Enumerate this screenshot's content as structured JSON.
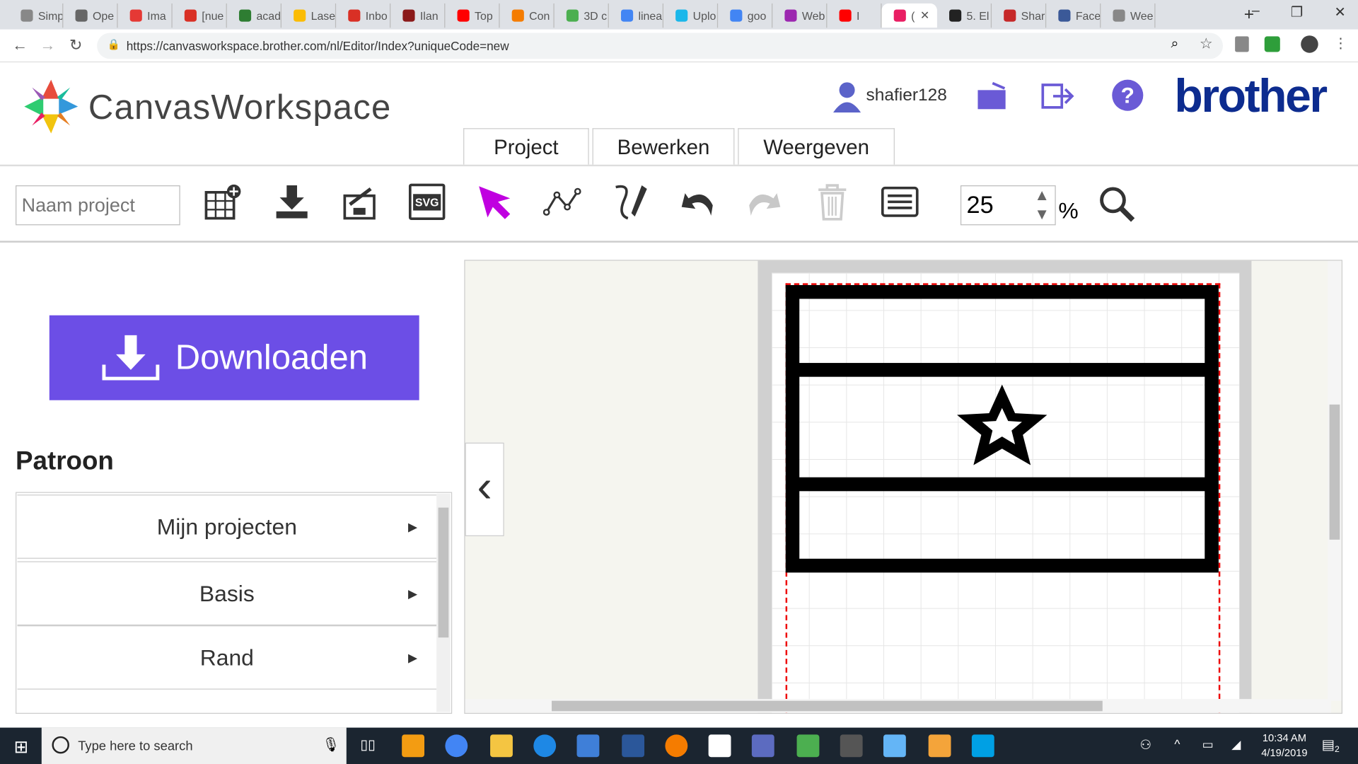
{
  "browser": {
    "tabs": [
      {
        "label": "Simp",
        "color": "#888"
      },
      {
        "label": "Ope",
        "color": "#666"
      },
      {
        "label": "Ima",
        "color": "#e53935"
      },
      {
        "label": "[nue",
        "color": "#d93025"
      },
      {
        "label": "acad",
        "color": "#2e7d32"
      },
      {
        "label": "Lase",
        "color": "#fbbc04"
      },
      {
        "label": "Inbo",
        "color": "#d93025"
      },
      {
        "label": "Ilan",
        "color": "#8b1a1a"
      },
      {
        "label": "Top",
        "color": "#ff0000"
      },
      {
        "label": "Con",
        "color": "#f57c00"
      },
      {
        "label": "3D c",
        "color": "#4caf50"
      },
      {
        "label": "linea",
        "color": "#4285f4"
      },
      {
        "label": "Uplo",
        "color": "#1ab7ea"
      },
      {
        "label": "goo",
        "color": "#4285f4"
      },
      {
        "label": "Web",
        "color": "#9c27b0"
      },
      {
        "label": "I",
        "color": "#ff0000"
      },
      {
        "label": "(",
        "color": "#e91e63"
      },
      {
        "label": "5. El",
        "color": "#222"
      },
      {
        "label": "Shar",
        "color": "#c62828"
      },
      {
        "label": "Face",
        "color": "#3b5998"
      },
      {
        "label": "Wee",
        "color": "#888"
      }
    ],
    "url": "https://canvasworkspace.brother.com/nl/Editor/Index?uniqueCode=new"
  },
  "app": {
    "logo_text": "CanvasWorkspace",
    "username": "shafier128",
    "brand": "brother",
    "brand_color": "#0d2c8f",
    "menu_tabs": [
      "Project",
      "Bewerken",
      "Weergeven"
    ],
    "project_name_placeholder": "Naam project",
    "zoom_value": "25",
    "zoom_unit": "%",
    "download_label": "Downloaden",
    "download_color": "#6c4ee6",
    "section_title": "Patroon",
    "pattern_items": [
      "Mijn projecten",
      "Basis",
      "Rand"
    ],
    "tools": [
      "new-grid-icon",
      "download-icon",
      "import-icon",
      "svg-icon",
      "select-arrow-icon",
      "node-edit-icon",
      "pen-icon",
      "undo-icon",
      "redo-icon",
      "trash-icon",
      "list-icon"
    ],
    "svg_label": "SVG",
    "selected_tool": "select-arrow-icon",
    "accent": "#c000e0"
  },
  "taskbar": {
    "search_placeholder": "Type here to search",
    "time": "10:34 AM",
    "date": "4/19/2019",
    "notification_count": "2"
  }
}
